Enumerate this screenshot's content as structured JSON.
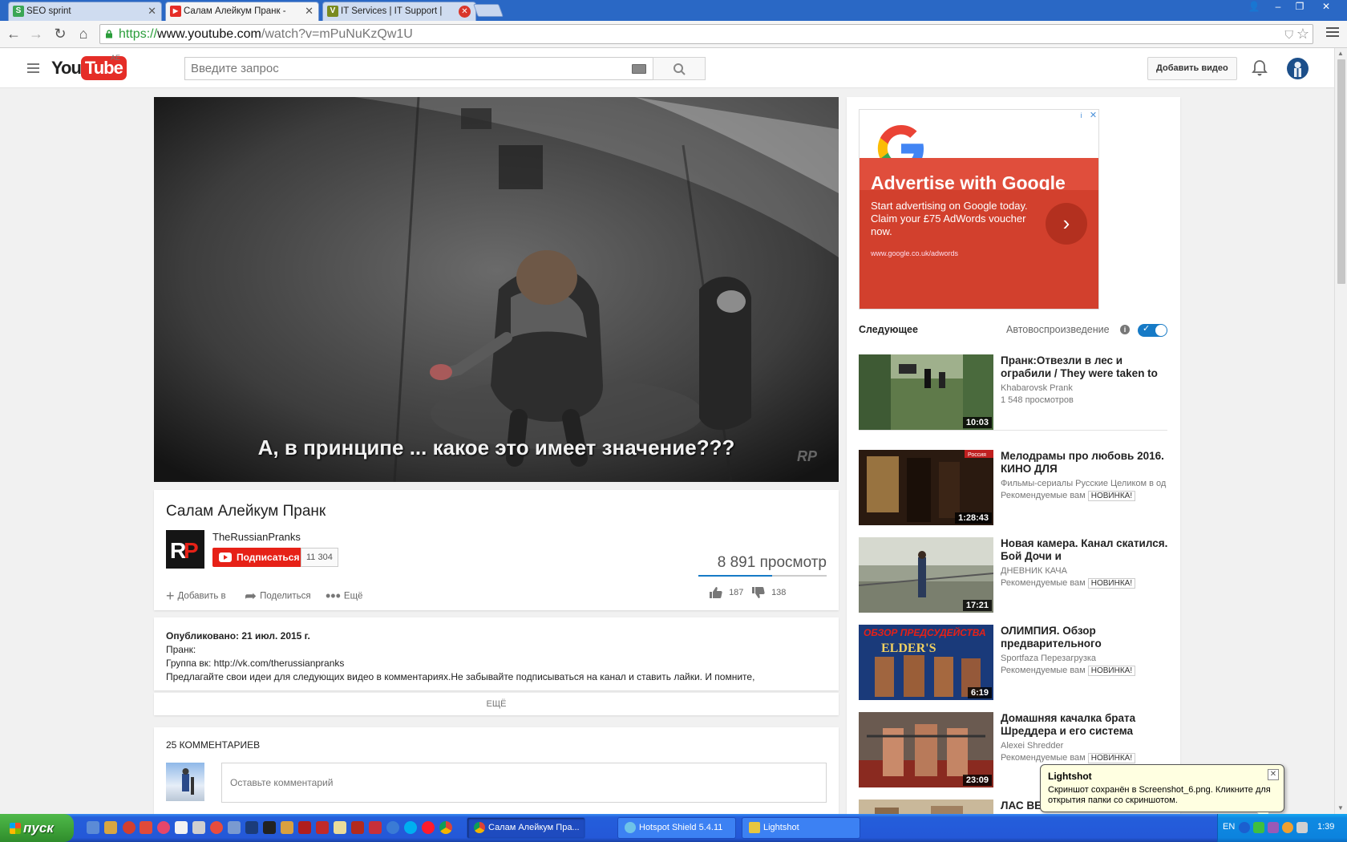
{
  "browser": {
    "tabs": [
      {
        "label": "SEO sprint",
        "favicon": "seo-sprint-icon"
      },
      {
        "label": "Салам Алейкум Пранк - YouTube",
        "favicon": "youtube-icon"
      },
      {
        "label": "IT Services | IT Support | Bu",
        "favicon": "v-site-icon"
      }
    ],
    "url_scheme": "https://",
    "url_host": "www.youtube.com",
    "url_rest": "/watch?v=mPuNuKzQw1U"
  },
  "youtube": {
    "region": "AE",
    "logo_you": "You",
    "logo_tube": "Tube",
    "search_placeholder": "Введите запрос",
    "upload_label": "Добавить видео",
    "video": {
      "subtitle": "А, в принципе ... какое это имеет значение???",
      "watermark": "RP",
      "title": "Салам Алейкум Пранк",
      "channel": "TheRussianPranks",
      "subscribe_label": "Подписаться",
      "subscriber_count": "11 304",
      "views": "8 891 просмотр",
      "like_ratio": 0.575,
      "add_to_label": "Добавить в",
      "share_label": "Поделиться",
      "more_label": "Ещё",
      "likes": "187",
      "dislikes": "138"
    },
    "description": {
      "published": "Опубликовано: 21 июл. 2015 г.",
      "line1": "Пранк:",
      "line2": "Группа вк: http://vk.com/therussianpranks",
      "line3": "Предлагайте свои идеи для следующих видео в комментариях.Не забывайте подписываться на канал и ставить лайки. И помните,",
      "show_more": "ЕЩЁ"
    },
    "comments": {
      "header": "25 КОММЕНТАРИЕВ",
      "placeholder": "Оставьте комментарий"
    },
    "ad": {
      "headline": "Advertise with Google",
      "text": "Start advertising on Google today. Claim your £75 AdWords voucher now.",
      "url": "www.google.co.uk/adwords",
      "close": "✕",
      "info": "i"
    },
    "up_next": {
      "label": "Следующее",
      "autoplay_label": "Автовоспроизведение",
      "info": "i"
    },
    "related": [
      {
        "title": "Пранк:Отвезли в лес и ограбили / They were taken to",
        "channel": "Khabarovsk Prank",
        "meta": "1 548 просмотров",
        "badge": "",
        "duration": "10:03"
      },
      {
        "title": "Мелодрамы про любовь 2016. КИНО ДЛЯ",
        "channel": "Фильмы-сериалы Русские Целиком в од",
        "meta": "Рекомендуемые вам",
        "badge": "НОВИНКА!",
        "duration": "1:28:43",
        "corner_label": "Россия"
      },
      {
        "title": "Новая камера. Канал скатился. Бой Дочи и",
        "channel": "ДНЕВНИК КАЧА",
        "meta": "Рекомендуемые вам",
        "badge": "НОВИНКА!",
        "duration": "17:21"
      },
      {
        "title": "ОЛИМПИЯ. Обзор предварительного",
        "channel": "Sportfaza Перезагрузка",
        "meta": "Рекомендуемые вам",
        "badge": "НОВИНКА!",
        "duration": "6:19",
        "thumb_text": "ОБЗОР ПРЕДСУДЕЙСТВА",
        "thumb_text2": "ELDER'S"
      },
      {
        "title": "Домашняя качалка брата Шреддера и его система",
        "channel": "Alexei Shredder",
        "meta": "Рекомендуемые вам",
        "badge": "НОВИНКА!",
        "duration": "23:09"
      },
      {
        "title": "ЛАС ВЕГАС ВОВЫ",
        "channel": "",
        "meta": "",
        "badge": "",
        "duration": ""
      }
    ]
  },
  "lightshot": {
    "title": "Lightshot",
    "text": "Скриншот сохранён в Screenshot_6.png. Кликните для открытия папки со скриншотом.",
    "close": "✕"
  },
  "taskbar": {
    "start_label": "пуск",
    "tasks": [
      "Салам Алейкум Пра...",
      "Hotspot Shield 5.4.11",
      "Lightshot"
    ],
    "lang": "EN",
    "clock": "1:39"
  }
}
